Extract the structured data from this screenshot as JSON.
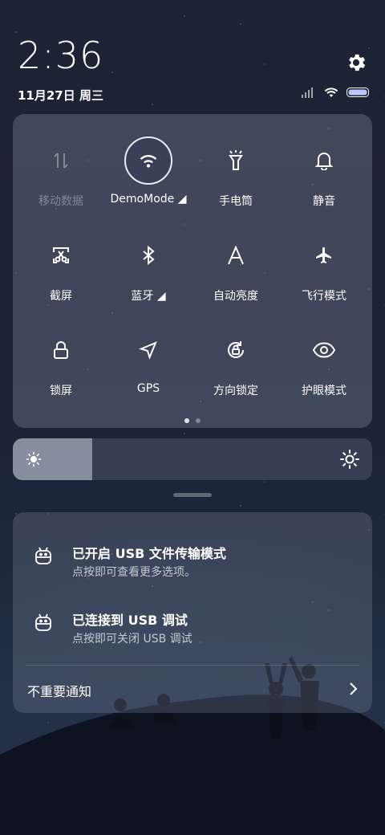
{
  "status_bar": {
    "time": "2:36",
    "date": "11月27日 周三"
  },
  "quick_settings": {
    "tiles": [
      {
        "label": "移动数据",
        "icon": "mobile-data-icon",
        "state": "disabled"
      },
      {
        "label": "DemoMode ◢",
        "icon": "wifi-icon",
        "state": "active"
      },
      {
        "label": "手电筒",
        "icon": "flashlight-icon",
        "state": "off"
      },
      {
        "label": "静音",
        "icon": "bell-icon",
        "state": "off"
      },
      {
        "label": "截屏",
        "icon": "screenshot-icon",
        "state": "off"
      },
      {
        "label": "蓝牙 ◢",
        "icon": "bluetooth-icon",
        "state": "off"
      },
      {
        "label": "自动亮度",
        "icon": "auto-brightness-icon",
        "state": "off"
      },
      {
        "label": "飞行模式",
        "icon": "airplane-icon",
        "state": "off"
      },
      {
        "label": "锁屏",
        "icon": "lock-icon",
        "state": "off"
      },
      {
        "label": "GPS",
        "icon": "location-icon",
        "state": "off"
      },
      {
        "label": "方向锁定",
        "icon": "rotation-lock-icon",
        "state": "off"
      },
      {
        "label": "护眼模式",
        "icon": "eye-icon",
        "state": "off"
      }
    ],
    "page_count": 2,
    "current_page": 1
  },
  "brightness": {
    "level": 0.22
  },
  "notifications": {
    "items": [
      {
        "title": "已开启 USB 文件传输模式",
        "subtitle": "点按即可查看更多选项。",
        "icon": "android-icon"
      },
      {
        "title": "已连接到 USB 调试",
        "subtitle": "点按即可关闭 USB 调试",
        "icon": "android-icon"
      }
    ],
    "unimportant_label": "不重要通知"
  },
  "colors": {
    "active_tile_bg": "#3a4058",
    "panel_bg": "rgba(160,170,190,.28)"
  }
}
